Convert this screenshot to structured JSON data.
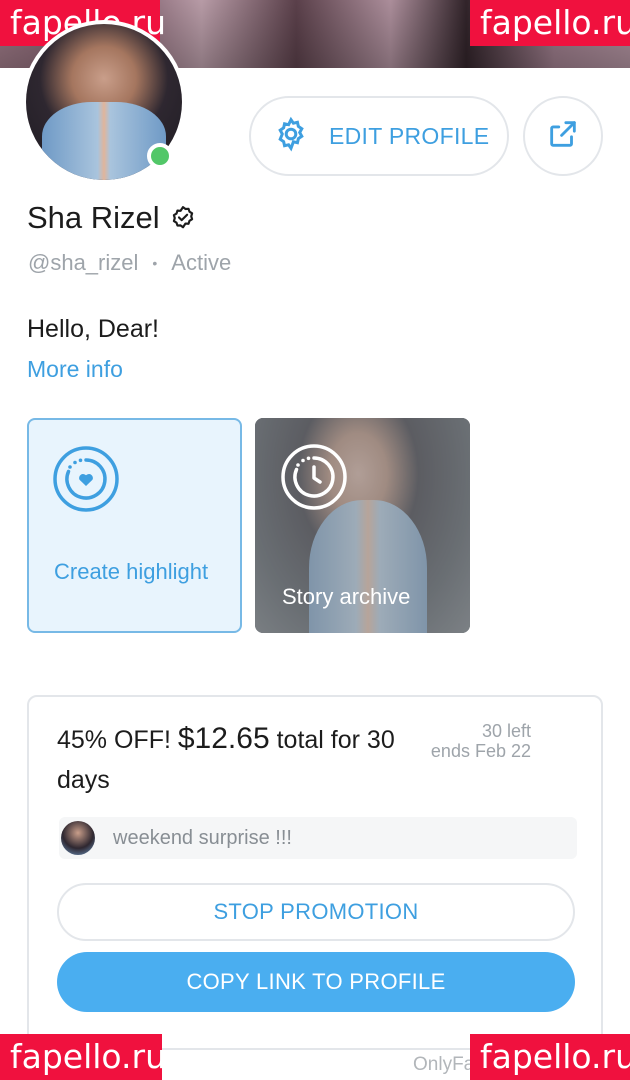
{
  "watermark": {
    "text": "fapello.ru",
    "color": "#f0113e"
  },
  "profile": {
    "name": "Sha Rizel",
    "verified_icon": "verified-badge-icon",
    "handle": "@sha_rizel",
    "separator": "•",
    "status": "Active",
    "online": true
  },
  "actions": {
    "edit_label": "EDIT PROFILE",
    "edit_icon": "gear-icon",
    "share_icon": "share-icon"
  },
  "bio": {
    "text": "Hello, Dear!",
    "more_label": "More info"
  },
  "highlights": [
    {
      "label": "Create highlight",
      "icon": "heart-circle-icon"
    },
    {
      "label": "Story archive",
      "icon": "clock-circle-icon"
    }
  ],
  "promotion": {
    "discount": "45% OFF!",
    "price": "$12.65",
    "rest": "total for 30 days",
    "left": "30 left",
    "ends": "ends Feb 22",
    "message": "weekend surprise !!!",
    "stop_label": "STOP PROMOTION",
    "copy_label": "COPY LINK TO PROFILE"
  },
  "footer": {
    "text": "OnlyFans"
  },
  "colors": {
    "accent": "#3e9fe0",
    "online": "#52c768",
    "button_fill": "#4aaef0"
  }
}
